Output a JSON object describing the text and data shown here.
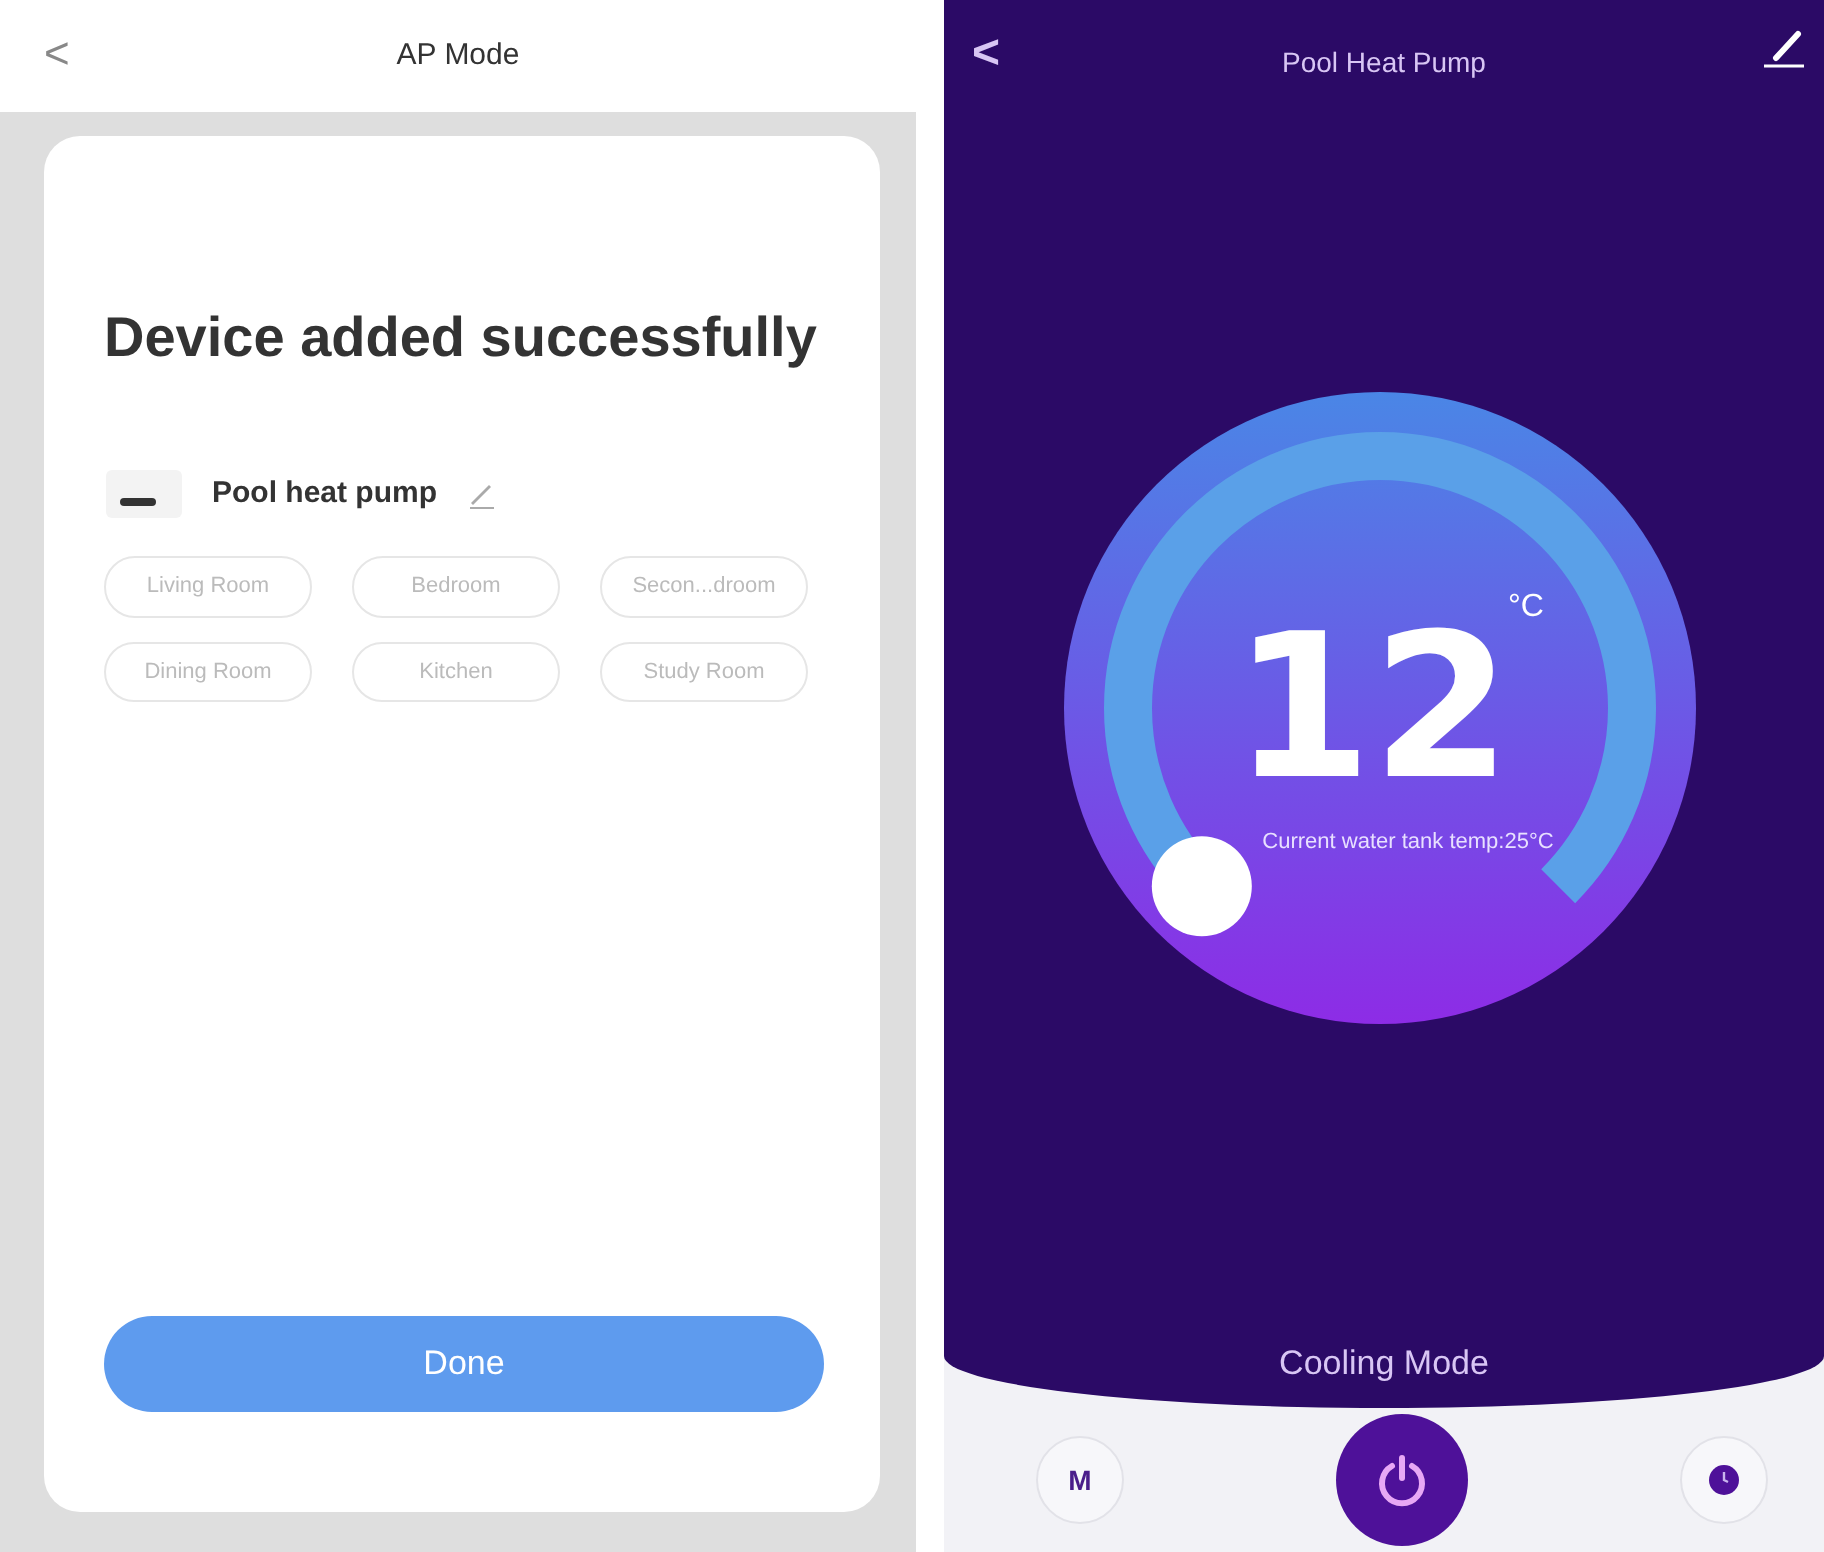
{
  "left_screen": {
    "header": {
      "back": "<",
      "title": "AP Mode"
    },
    "heading": "Device added successfully",
    "device": {
      "name": "Pool heat pump"
    },
    "rooms": [
      {
        "label": "Living Room",
        "selected": false
      },
      {
        "label": "Bedroom",
        "selected": false
      },
      {
        "label": "Secon...droom",
        "selected": false
      },
      {
        "label": "Dining Room",
        "selected": false
      },
      {
        "label": "Kitchen",
        "selected": false
      },
      {
        "label": "Study Room",
        "selected": false
      }
    ],
    "done_button": "Done"
  },
  "right_screen": {
    "header": {
      "back": "<",
      "title": "Pool Heat Pump"
    },
    "dial": {
      "temperature": "12",
      "unit": "°C",
      "current_temp": "Current water tank temp:25°C"
    },
    "mode": "Cooling Mode",
    "controls": [
      {
        "kind": "mode",
        "label": "M"
      },
      {
        "kind": "power"
      },
      {
        "kind": "timer"
      }
    ]
  }
}
